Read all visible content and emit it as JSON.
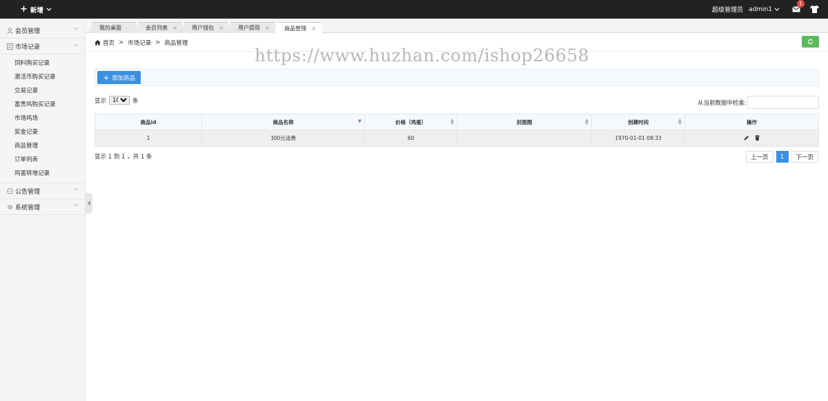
{
  "topbar": {
    "new_label": "新增",
    "role": "超级管理员",
    "user": "admin1",
    "msg_count": "1"
  },
  "sidebar": {
    "groups": [
      {
        "label": "会员管理",
        "icon": "user-icon"
      },
      {
        "label": "市场记录",
        "icon": "list-icon",
        "items": [
          "饲料购买记录",
          "激活币购买记录",
          "交易记录",
          "富贵鸡购买记录",
          "市场鸡场",
          "奖金记录",
          "商品管理",
          "订单列表",
          "鸡蛋转增记录"
        ]
      },
      {
        "label": "公告管理",
        "icon": "chat-icon"
      },
      {
        "label": "系统管理",
        "icon": "gear-icon"
      }
    ]
  },
  "tabs": [
    {
      "label": "我的桌面"
    },
    {
      "label": "会员列表"
    },
    {
      "label": "用户钱包"
    },
    {
      "label": "用户提现"
    },
    {
      "label": "商品管理"
    }
  ],
  "breadcrumb": {
    "home": "首页",
    "sep": ">",
    "level1": "市场记录",
    "level2": "商品管理"
  },
  "watermark": "https://www.huzhan.com/ishop26658",
  "toolbar": {
    "add_label": "添加商品"
  },
  "length": {
    "prefix": "显示",
    "value": "10",
    "suffix": "条"
  },
  "search": {
    "label": "从当前数据中检索:",
    "value": ""
  },
  "table": {
    "headers": [
      "商品id",
      "商品名称",
      "价格（鸡蛋）",
      "封面图",
      "创建时间",
      "操作"
    ],
    "rows": [
      {
        "id": "1",
        "name": "300元话费",
        "price": "60",
        "cover": "",
        "created": "1970-01-01 08:33"
      }
    ]
  },
  "info": "显示 1 到 1 ，共 1 条",
  "pager": {
    "prev": "上一页",
    "current": "1",
    "next": "下一页"
  },
  "colors": {
    "topbar": "#222222",
    "primary": "#3b8fe0",
    "refresh": "#5eb95e",
    "badge": "#e74c3c"
  }
}
